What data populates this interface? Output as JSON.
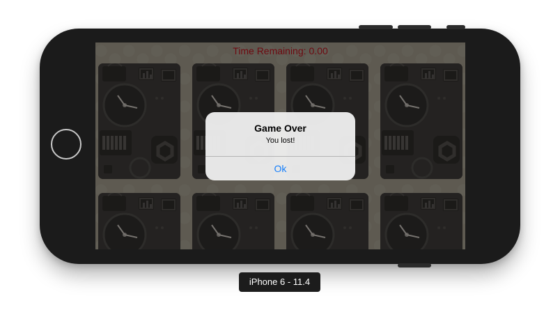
{
  "timer": {
    "label": "Time Remaining:",
    "value": "0.00"
  },
  "cards": {
    "count": 8,
    "state": "face-down",
    "pattern": "gadget-illustration"
  },
  "alert": {
    "title": "Game Over",
    "message": "You lost!",
    "button_label": "Ok"
  },
  "device": {
    "label": "iPhone 6 - 11.4"
  },
  "colors": {
    "timer_text": "#b0101a",
    "alert_button": "#157efb",
    "phone_body": "#1b1b1b"
  }
}
